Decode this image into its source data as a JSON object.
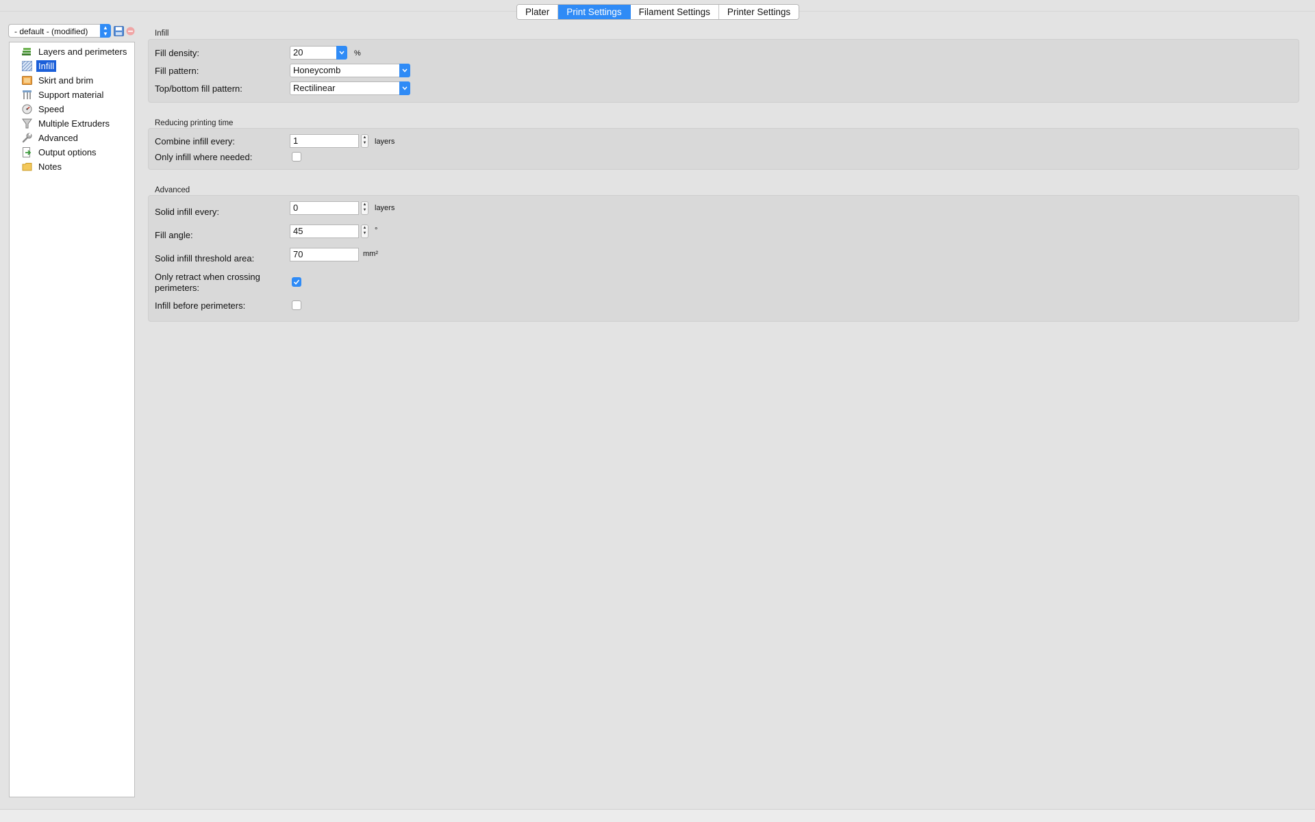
{
  "tabs": [
    {
      "label": "Plater",
      "active": false
    },
    {
      "label": "Print Settings",
      "active": true
    },
    {
      "label": "Filament Settings",
      "active": false
    },
    {
      "label": "Printer Settings",
      "active": false
    }
  ],
  "preset": {
    "selected": "- default - (modified)"
  },
  "sidebar": {
    "items": [
      {
        "label": "Layers and perimeters",
        "icon": "layers-icon"
      },
      {
        "label": "Infill",
        "icon": "infill-icon",
        "selected": true
      },
      {
        "label": "Skirt and brim",
        "icon": "skirt-brim-icon"
      },
      {
        "label": "Support material",
        "icon": "support-material-icon"
      },
      {
        "label": "Speed",
        "icon": "speed-icon"
      },
      {
        "label": "Multiple Extruders",
        "icon": "extruders-icon"
      },
      {
        "label": "Advanced",
        "icon": "wrench-icon"
      },
      {
        "label": "Output options",
        "icon": "output-icon"
      },
      {
        "label": "Notes",
        "icon": "notes-icon"
      }
    ]
  },
  "groups": {
    "infill": {
      "title": "Infill",
      "fill_density": {
        "label": "Fill density:",
        "value": "20",
        "unit": "%"
      },
      "fill_pattern": {
        "label": "Fill pattern:",
        "value": "Honeycomb"
      },
      "top_bottom_fill_pattern": {
        "label": "Top/bottom fill pattern:",
        "value": "Rectilinear"
      }
    },
    "reducing": {
      "title": "Reducing printing time",
      "combine_infill": {
        "label": "Combine infill every:",
        "value": "1",
        "unit": "layers"
      },
      "only_infill_needed": {
        "label": "Only infill where needed:",
        "checked": false
      }
    },
    "advanced": {
      "title": "Advanced",
      "solid_infill_every": {
        "label": "Solid infill every:",
        "value": "0",
        "unit": "layers"
      },
      "fill_angle": {
        "label": "Fill angle:",
        "value": "45",
        "unit": "°"
      },
      "solid_threshold": {
        "label": "Solid infill threshold area:",
        "value": "70",
        "unit": "mm²"
      },
      "only_retract": {
        "label_line1": "Only retract when crossing",
        "label_line2": "perimeters:",
        "checked": true
      },
      "infill_before": {
        "label": "Infill before perimeters:",
        "checked": false
      }
    }
  },
  "colors": {
    "accent": "#2f8bf6",
    "selection": "#1b5fd9",
    "group_bg": "#d9d9d9"
  }
}
